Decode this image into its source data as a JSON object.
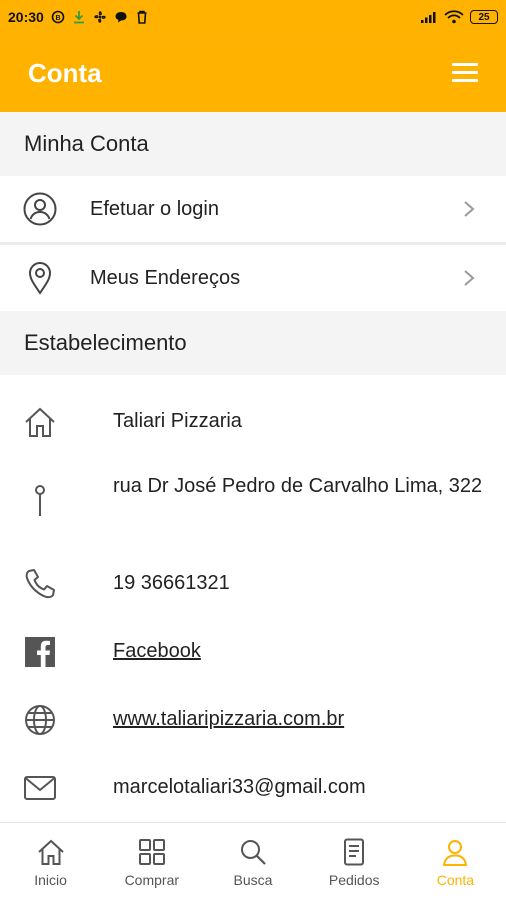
{
  "status_bar": {
    "time": "20:30",
    "battery": "25",
    "icons": [
      "notification-icon",
      "download-icon",
      "fan-icon",
      "chat-icon",
      "trash-icon",
      "signal-icon",
      "wifi-icon",
      "battery-icon"
    ]
  },
  "app_bar": {
    "title": "Conta",
    "menu_icon": "hamburger-menu-icon"
  },
  "account_section": {
    "title": "Minha Conta",
    "items": [
      {
        "label": "Efetuar o login",
        "icon": "user-circle-icon"
      },
      {
        "label": "Meus Endereços",
        "icon": "location-pin-icon"
      }
    ]
  },
  "establishment_section": {
    "title": "Estabelecimento",
    "name": "Taliari Pizzaria",
    "address": "rua Dr José Pedro de Carvalho Lima, 322",
    "phone": "19 36661321",
    "facebook": "Facebook",
    "website": "www.taliaripizzaria.com.br",
    "email": "marcelotaliari33@gmail.com"
  },
  "tab_bar": {
    "tabs": [
      {
        "label": "Inicio",
        "icon": "home-icon"
      },
      {
        "label": "Comprar",
        "icon": "grid-icon"
      },
      {
        "label": "Busca",
        "icon": "search-icon"
      },
      {
        "label": "Pedidos",
        "icon": "receipt-icon"
      },
      {
        "label": "Conta",
        "icon": "user-icon"
      }
    ],
    "active_tab": "Conta"
  },
  "colors": {
    "accent": "#FFB300",
    "link": "#1a0dab",
    "section_bg": "#f4f4f4"
  }
}
